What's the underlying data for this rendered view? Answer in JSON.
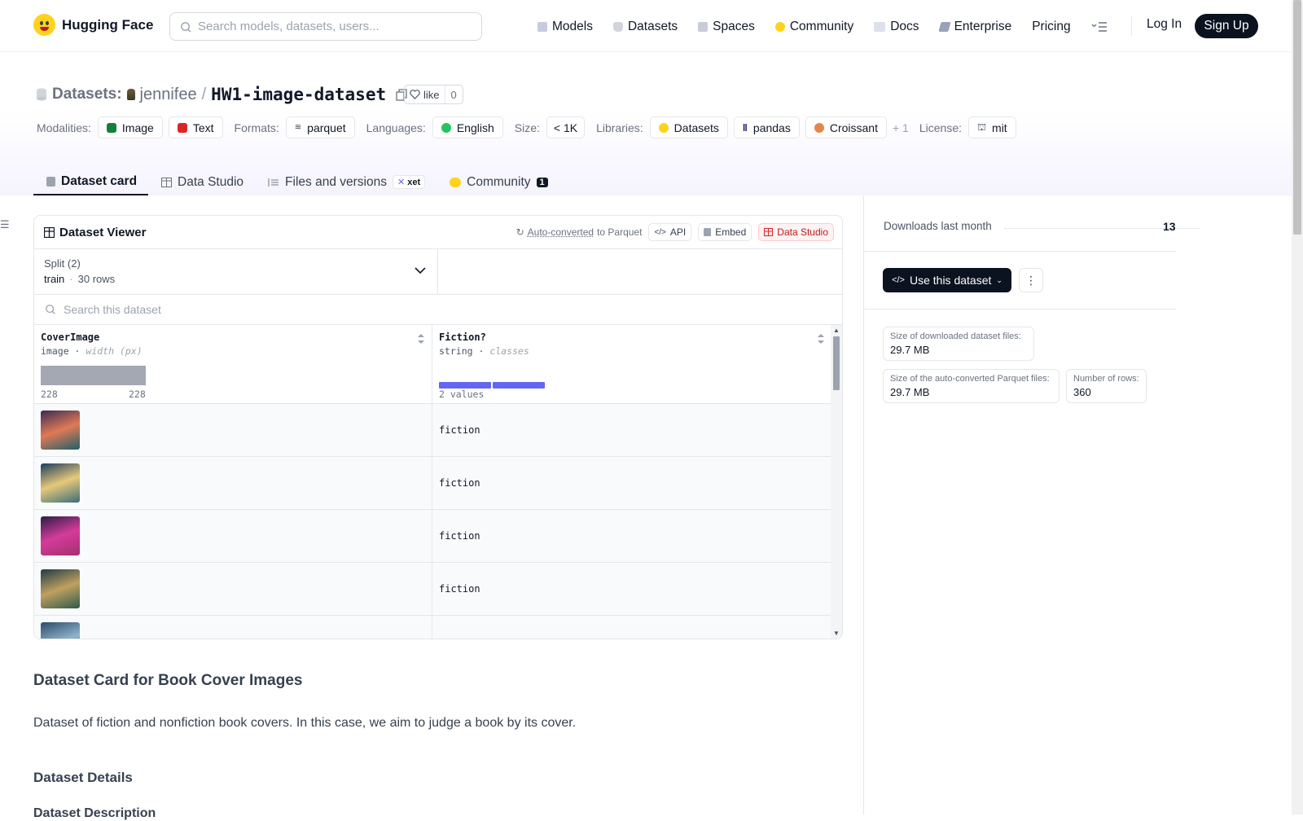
{
  "nav": {
    "brand": "Hugging Face",
    "search_placeholder": "Search models, datasets, users...",
    "items": [
      {
        "label": "Models",
        "icon": "models-icon"
      },
      {
        "label": "Datasets",
        "icon": "datasets-icon"
      },
      {
        "label": "Spaces",
        "icon": "spaces-icon"
      },
      {
        "label": "Community",
        "icon": "community-icon"
      },
      {
        "label": "Docs",
        "icon": "docs-icon"
      },
      {
        "label": "Enterprise",
        "icon": "enterprise-icon"
      },
      {
        "label": "Pricing",
        "icon": ""
      }
    ],
    "login": "Log In",
    "signup": "Sign Up"
  },
  "header": {
    "section": "Datasets:",
    "user": "jennifee",
    "separator": "/",
    "repo": "HW1-image-dataset",
    "like_label": "like",
    "like_count": "0",
    "modalities_label": "Modalities:",
    "modalities": [
      "Image",
      "Text"
    ],
    "formats_label": "Formats:",
    "formats": [
      "parquet"
    ],
    "languages_label": "Languages:",
    "languages": [
      "English"
    ],
    "size_label": "Size:",
    "size": "< 1K",
    "libraries_label": "Libraries:",
    "libraries": [
      "Datasets",
      "pandas",
      "Croissant"
    ],
    "libraries_more": "+ 1",
    "license_label": "License:",
    "license": "mit"
  },
  "tabs": [
    {
      "label": "Dataset card",
      "active": true
    },
    {
      "label": "Data Studio"
    },
    {
      "label": "Files and versions",
      "badge": "xet"
    },
    {
      "label": "Community",
      "badge": "1"
    }
  ],
  "viewer": {
    "title": "Dataset Viewer",
    "auto_converted": "Auto-converted",
    "to_parquet": "to Parquet",
    "api": "API",
    "embed": "Embed",
    "data_studio": "Data Studio",
    "split_label": "Split (2)",
    "split_value": "train",
    "split_rows": "30 rows",
    "search_placeholder": "Search this dataset",
    "columns": [
      {
        "name": "CoverImage",
        "type": "image",
        "subtype": "width (px)",
        "min": "228",
        "max": "228"
      },
      {
        "name": "Fiction?",
        "type": "string",
        "subtype": "classes",
        "summary": "2 values"
      }
    ],
    "rows": [
      {
        "value": "fiction",
        "thumb_colors": [
          "#3b2a55",
          "#e07a55",
          "#1f5f6a"
        ]
      },
      {
        "value": "fiction",
        "thumb_colors": [
          "#1d3b5e",
          "#e6c97a",
          "#3a6d7a"
        ]
      },
      {
        "value": "fiction",
        "thumb_colors": [
          "#2a1e45",
          "#d43b9b",
          "#a4306e"
        ]
      },
      {
        "value": "fiction",
        "thumb_colors": [
          "#1d3a45",
          "#c0a060",
          "#2e5a4a"
        ]
      },
      {
        "value": "",
        "thumb_colors": [
          "#2c4a6a",
          "#8fb4cc",
          "#1f3550"
        ]
      }
    ]
  },
  "content": {
    "heading": "Dataset Card for Book Cover Images",
    "paragraph": "Dataset of fiction and nonfiction book covers. In this case, we aim to judge a book by its cover.",
    "details": "Dataset Details",
    "description": "Dataset Description"
  },
  "sidebar": {
    "downloads_label": "Downloads last month",
    "downloads": "13",
    "use_button": "Use this dataset",
    "stats": [
      {
        "label": "Size of downloaded dataset files:",
        "value": "29.7 MB"
      },
      {
        "label": "Size of the auto-converted Parquet files:",
        "value": "29.7 MB"
      },
      {
        "label": "Number of rows:",
        "value": "360"
      }
    ]
  },
  "colors": {
    "accent": "#6366f1",
    "dark": "#0b1220",
    "hf_yellow": "#ffd21e"
  }
}
